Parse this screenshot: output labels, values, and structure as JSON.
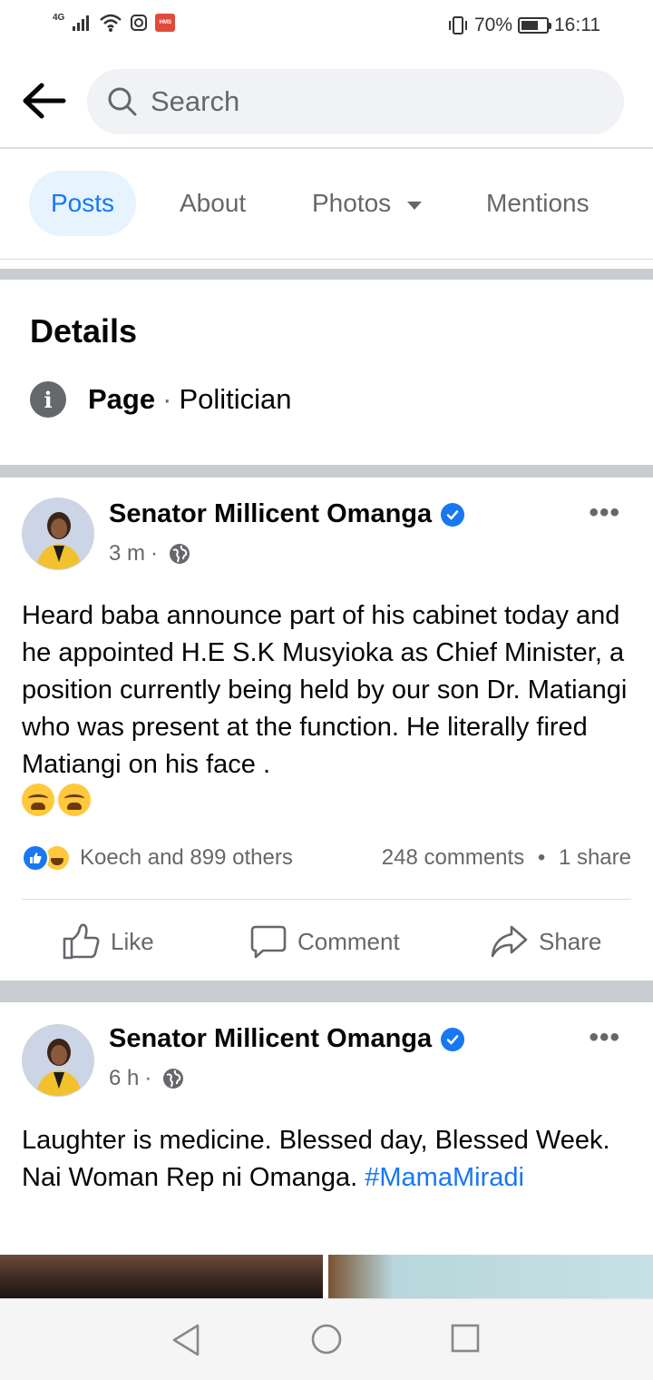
{
  "status_bar": {
    "network": "4G",
    "notification_badge": "HMS",
    "battery_percent": "70%",
    "battery_level": 0.7,
    "time": "16:11"
  },
  "search": {
    "placeholder": "Search"
  },
  "tabs": [
    {
      "label": "Posts",
      "active": true
    },
    {
      "label": "About",
      "active": false
    },
    {
      "label": "Photos",
      "active": false
    },
    {
      "label": "Mentions",
      "active": false
    }
  ],
  "details": {
    "title": "Details",
    "type_label": "Page",
    "separator": "·",
    "category": "Politician"
  },
  "posts": [
    {
      "author": "Senator Millicent Omanga",
      "verified": true,
      "time": "3 m",
      "meta_sep": "·",
      "text": "Heard baba announce part of his cabinet today and he appointed H.E S.K Musyioka as Chief Minister, a position currently being held by our son Dr. Matiangi who was present at the function. He literally fired Matiangi on his face .",
      "emojis": [
        "weary-face",
        "weary-face"
      ],
      "reactions_summary": "Koech and 899 others",
      "comments": "248 comments",
      "stats_sep": "•",
      "shares": "1 share",
      "actions": {
        "like": "Like",
        "comment": "Comment",
        "share": "Share"
      }
    },
    {
      "author": "Senator Millicent Omanga",
      "verified": true,
      "time": "6 h",
      "meta_sep": "·",
      "text_line1": "Laughter is medicine. Blessed day, Blessed Week.",
      "text_line2": "Nai Woman Rep ni Omanga.",
      "hashtag": "#MamaMiradi"
    }
  ],
  "colors": {
    "accent": "#1877f2",
    "active_tab_bg": "#e7f3ff",
    "muted_text": "#65676b",
    "divider": "#c9ccd1"
  }
}
